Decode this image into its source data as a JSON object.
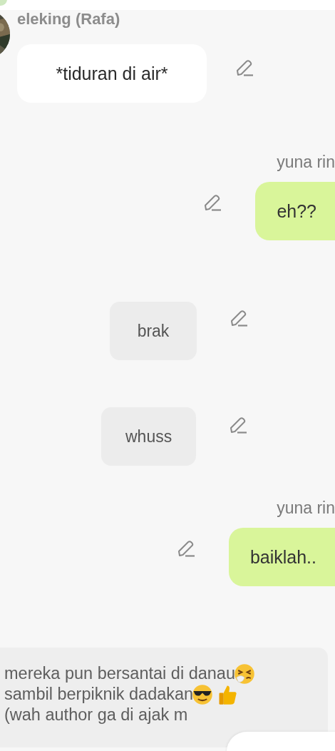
{
  "author": {
    "name": "eleking (Rafa)"
  },
  "messages": [
    {
      "kind": "incoming",
      "text": "*tiduran di air*"
    },
    {
      "kind": "sender",
      "text": "yuna rin"
    },
    {
      "kind": "outgoing",
      "text": "eh??"
    },
    {
      "kind": "narration",
      "text": "brak"
    },
    {
      "kind": "narration",
      "text": "whuss"
    },
    {
      "kind": "sender",
      "text": "yuna rin"
    },
    {
      "kind": "outgoing",
      "text": "baiklah.."
    }
  ],
  "story": {
    "lines": [
      "mereka pun bersantai di danau",
      "sambil berpiknik dadakan",
      "(wah author ga di ajak m"
    ]
  }
}
